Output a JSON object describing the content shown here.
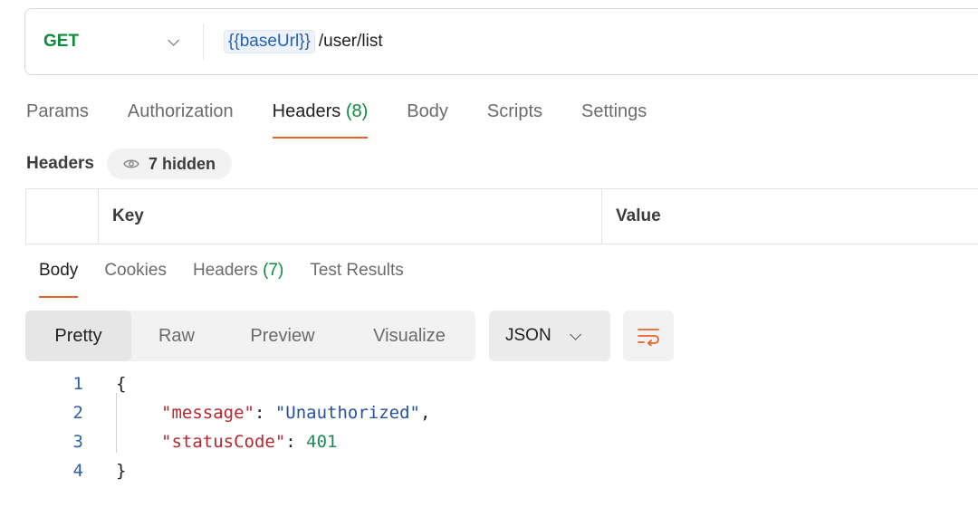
{
  "request": {
    "method": "GET",
    "url_variable": "{{baseUrl}}",
    "url_path": "/user/list"
  },
  "request_tabs": [
    {
      "label": "Params",
      "count": ""
    },
    {
      "label": "Authorization",
      "count": ""
    },
    {
      "label": "Headers",
      "count": "(8)"
    },
    {
      "label": "Body",
      "count": ""
    },
    {
      "label": "Scripts",
      "count": ""
    },
    {
      "label": "Settings",
      "count": ""
    }
  ],
  "headers_section": {
    "title": "Headers",
    "hidden_label": "7 hidden",
    "table": {
      "key_header": "Key",
      "value_header": "Value"
    }
  },
  "response_tabs": [
    {
      "label": "Body",
      "count": ""
    },
    {
      "label": "Cookies",
      "count": ""
    },
    {
      "label": "Headers",
      "count": "(7)"
    },
    {
      "label": "Test Results",
      "count": ""
    }
  ],
  "view_modes": [
    "Pretty",
    "Raw",
    "Preview",
    "Visualize"
  ],
  "format": "JSON",
  "response_body": {
    "lines": [
      {
        "number": "1",
        "text": "{"
      },
      {
        "number": "2",
        "key": "\"message\"",
        "value": "\"Unauthorized\"",
        "trail": ","
      },
      {
        "number": "3",
        "key": "\"statusCode\"",
        "value": "401",
        "trail": ""
      },
      {
        "number": "4",
        "text": "}"
      }
    ]
  },
  "colors": {
    "accent": "#e8612c",
    "method_get": "#0f8a3c",
    "json_key": "#b5262d",
    "json_string": "#2451a3",
    "json_number": "#1d8a5a"
  },
  "icons": [
    "chevron-down-icon",
    "eye-icon",
    "wrap-lines-icon"
  ]
}
